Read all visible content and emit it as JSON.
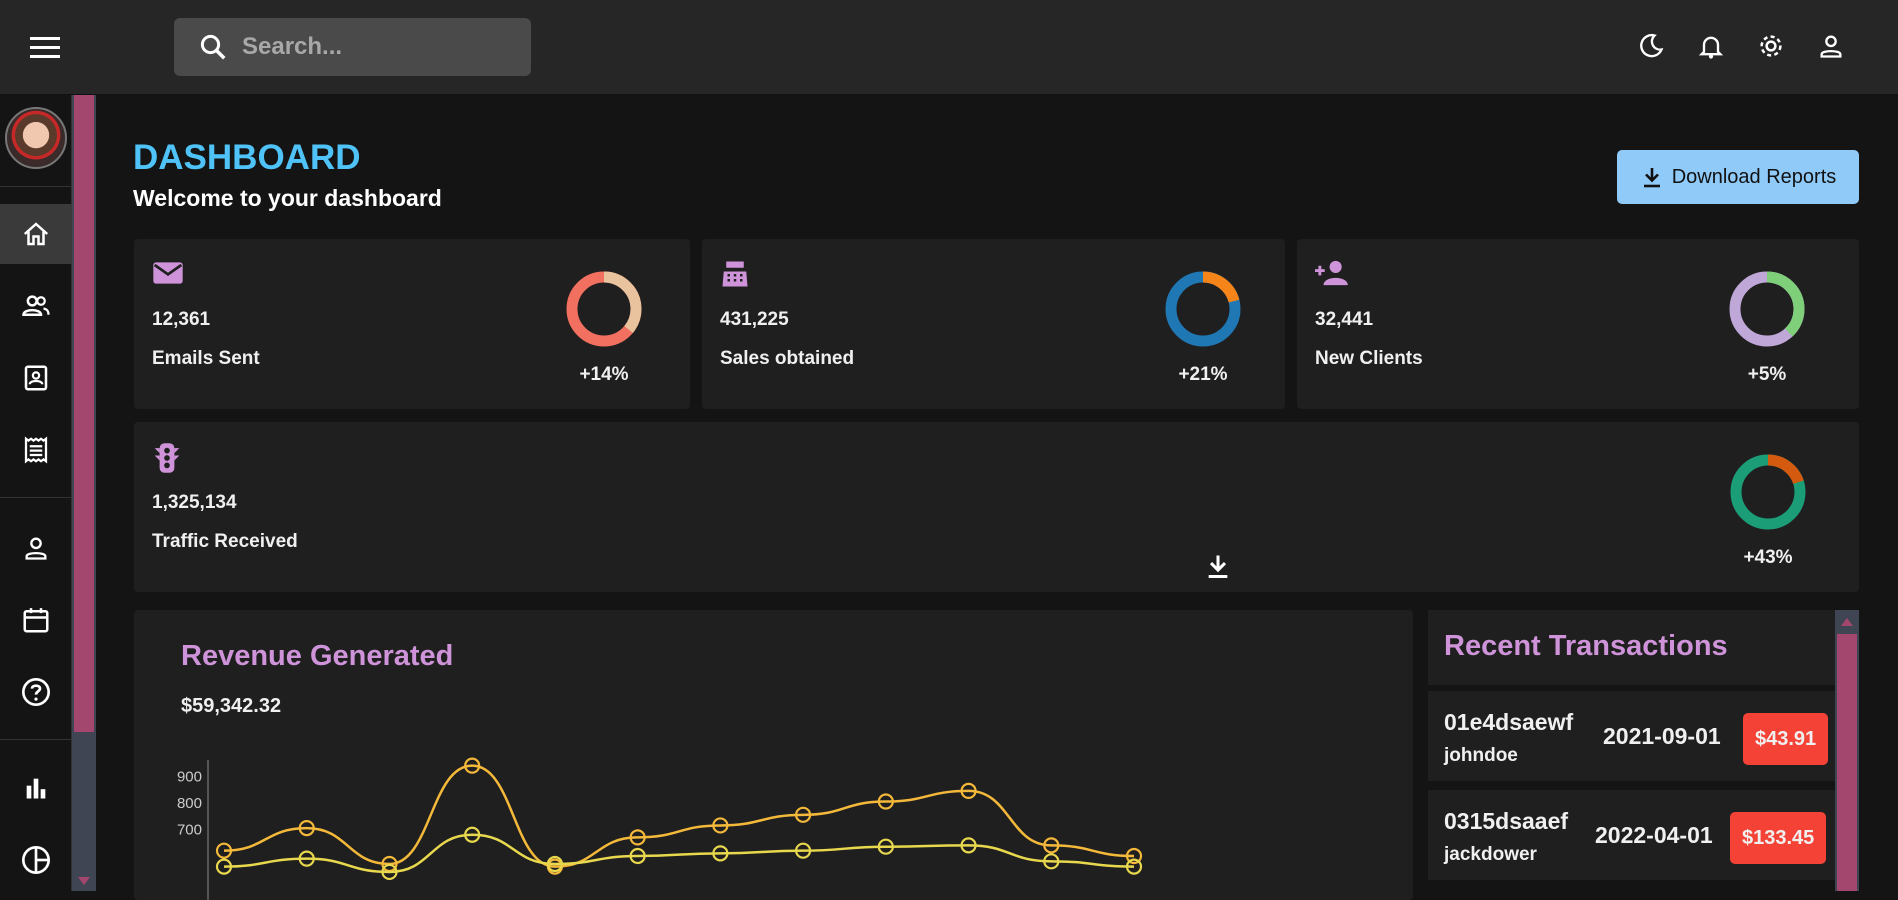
{
  "topbar": {
    "search_placeholder": "Search...",
    "icons": [
      "menu-icon",
      "search-icon",
      "moon-icon",
      "bell-icon",
      "gear-icon",
      "person-icon"
    ]
  },
  "sidebar": {
    "items": [
      "home-icon",
      "people-icon",
      "contacts-icon",
      "receipt-icon",
      "person-icon",
      "calendar-icon",
      "help-icon",
      "bar-chart-icon",
      "pie-chart-icon"
    ]
  },
  "header": {
    "title": "DASHBOARD",
    "subtitle": "Welcome to your dashboard",
    "download_label": "Download Reports"
  },
  "stats": [
    {
      "value": "12,361",
      "label": "Emails Sent",
      "pct": "+14%",
      "fraction": 0.36,
      "icon": "email-icon",
      "colors": [
        "#e8c39e",
        "#f2705f"
      ]
    },
    {
      "value": "431,225",
      "label": "Sales obtained",
      "pct": "+21%",
      "fraction": 0.21,
      "icon": "point-of-sale-icon",
      "colors": [
        "#f58518",
        "#1f77b4"
      ]
    },
    {
      "value": "32,441",
      "label": "New Clients",
      "pct": "+5%",
      "fraction": 0.38,
      "icon": "person-add-icon",
      "colors": [
        "#7fcf7a",
        "#bfa8d8"
      ]
    },
    {
      "value": "1,325,134",
      "label": "Traffic Received",
      "pct": "+43%",
      "fraction": 0.2,
      "icon": "traffic-icon",
      "colors": [
        "#d45a0f",
        "#1b9e77"
      ]
    }
  ],
  "revenue": {
    "title": "Revenue Generated",
    "amount": "$59,342.32"
  },
  "chart_data": {
    "type": "line",
    "x_index": [
      1,
      2,
      3,
      4,
      5,
      6,
      7,
      8,
      9,
      10,
      11,
      12
    ],
    "yticks": [
      700,
      800,
      900
    ],
    "series": [
      {
        "values": [
          620,
          705,
          570,
          940,
          560,
          670,
          715,
          755,
          805,
          845,
          640,
          600
        ],
        "color": "#f4b93a"
      },
      {
        "values": [
          560,
          590,
          540,
          680,
          570,
          600,
          610,
          620,
          635,
          640,
          580,
          560
        ],
        "color": "#e8d84e"
      }
    ]
  },
  "transactions": {
    "title": "Recent Transactions",
    "rows": [
      {
        "id": "01e4dsaewf",
        "user": "johndoe",
        "date": "2021-09-01",
        "amount": "$43.91"
      },
      {
        "id": "0315dsaaef",
        "user": "jackdower",
        "date": "2022-04-01",
        "amount": "$133.45"
      }
    ]
  }
}
